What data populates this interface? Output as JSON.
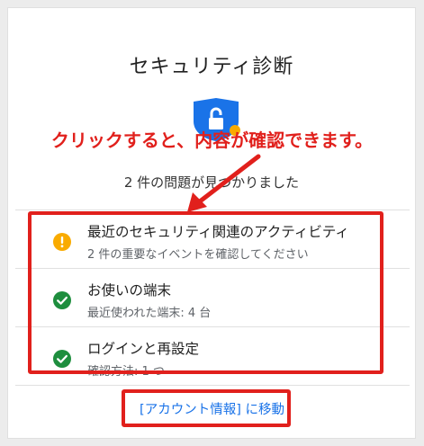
{
  "card": {
    "title": "セキュリティ診断",
    "summary": "2 件の問題が見つかりました",
    "items": [
      {
        "main": "最近のセキュリティ関連のアクティビティ",
        "sub": "2 件の重要なイベントを確認してください",
        "status": "warning",
        "icon": "warning-icon"
      },
      {
        "main": "お使いの端末",
        "sub": "最近使われた端末: 4 台",
        "status": "ok",
        "icon": "check-icon"
      },
      {
        "main": "ログインと再設定",
        "sub": "確認方法: 1 つ",
        "status": "ok",
        "icon": "check-icon"
      }
    ],
    "link": "[アカウント情報] に移動"
  },
  "annotation": {
    "text": "クリックすると、内容が確認できます。",
    "color": "#e1201c"
  },
  "colors": {
    "warning": "#f9ab00",
    "ok": "#1e8e3e",
    "link": "#1a73e8",
    "shield": "#1a73e8"
  }
}
